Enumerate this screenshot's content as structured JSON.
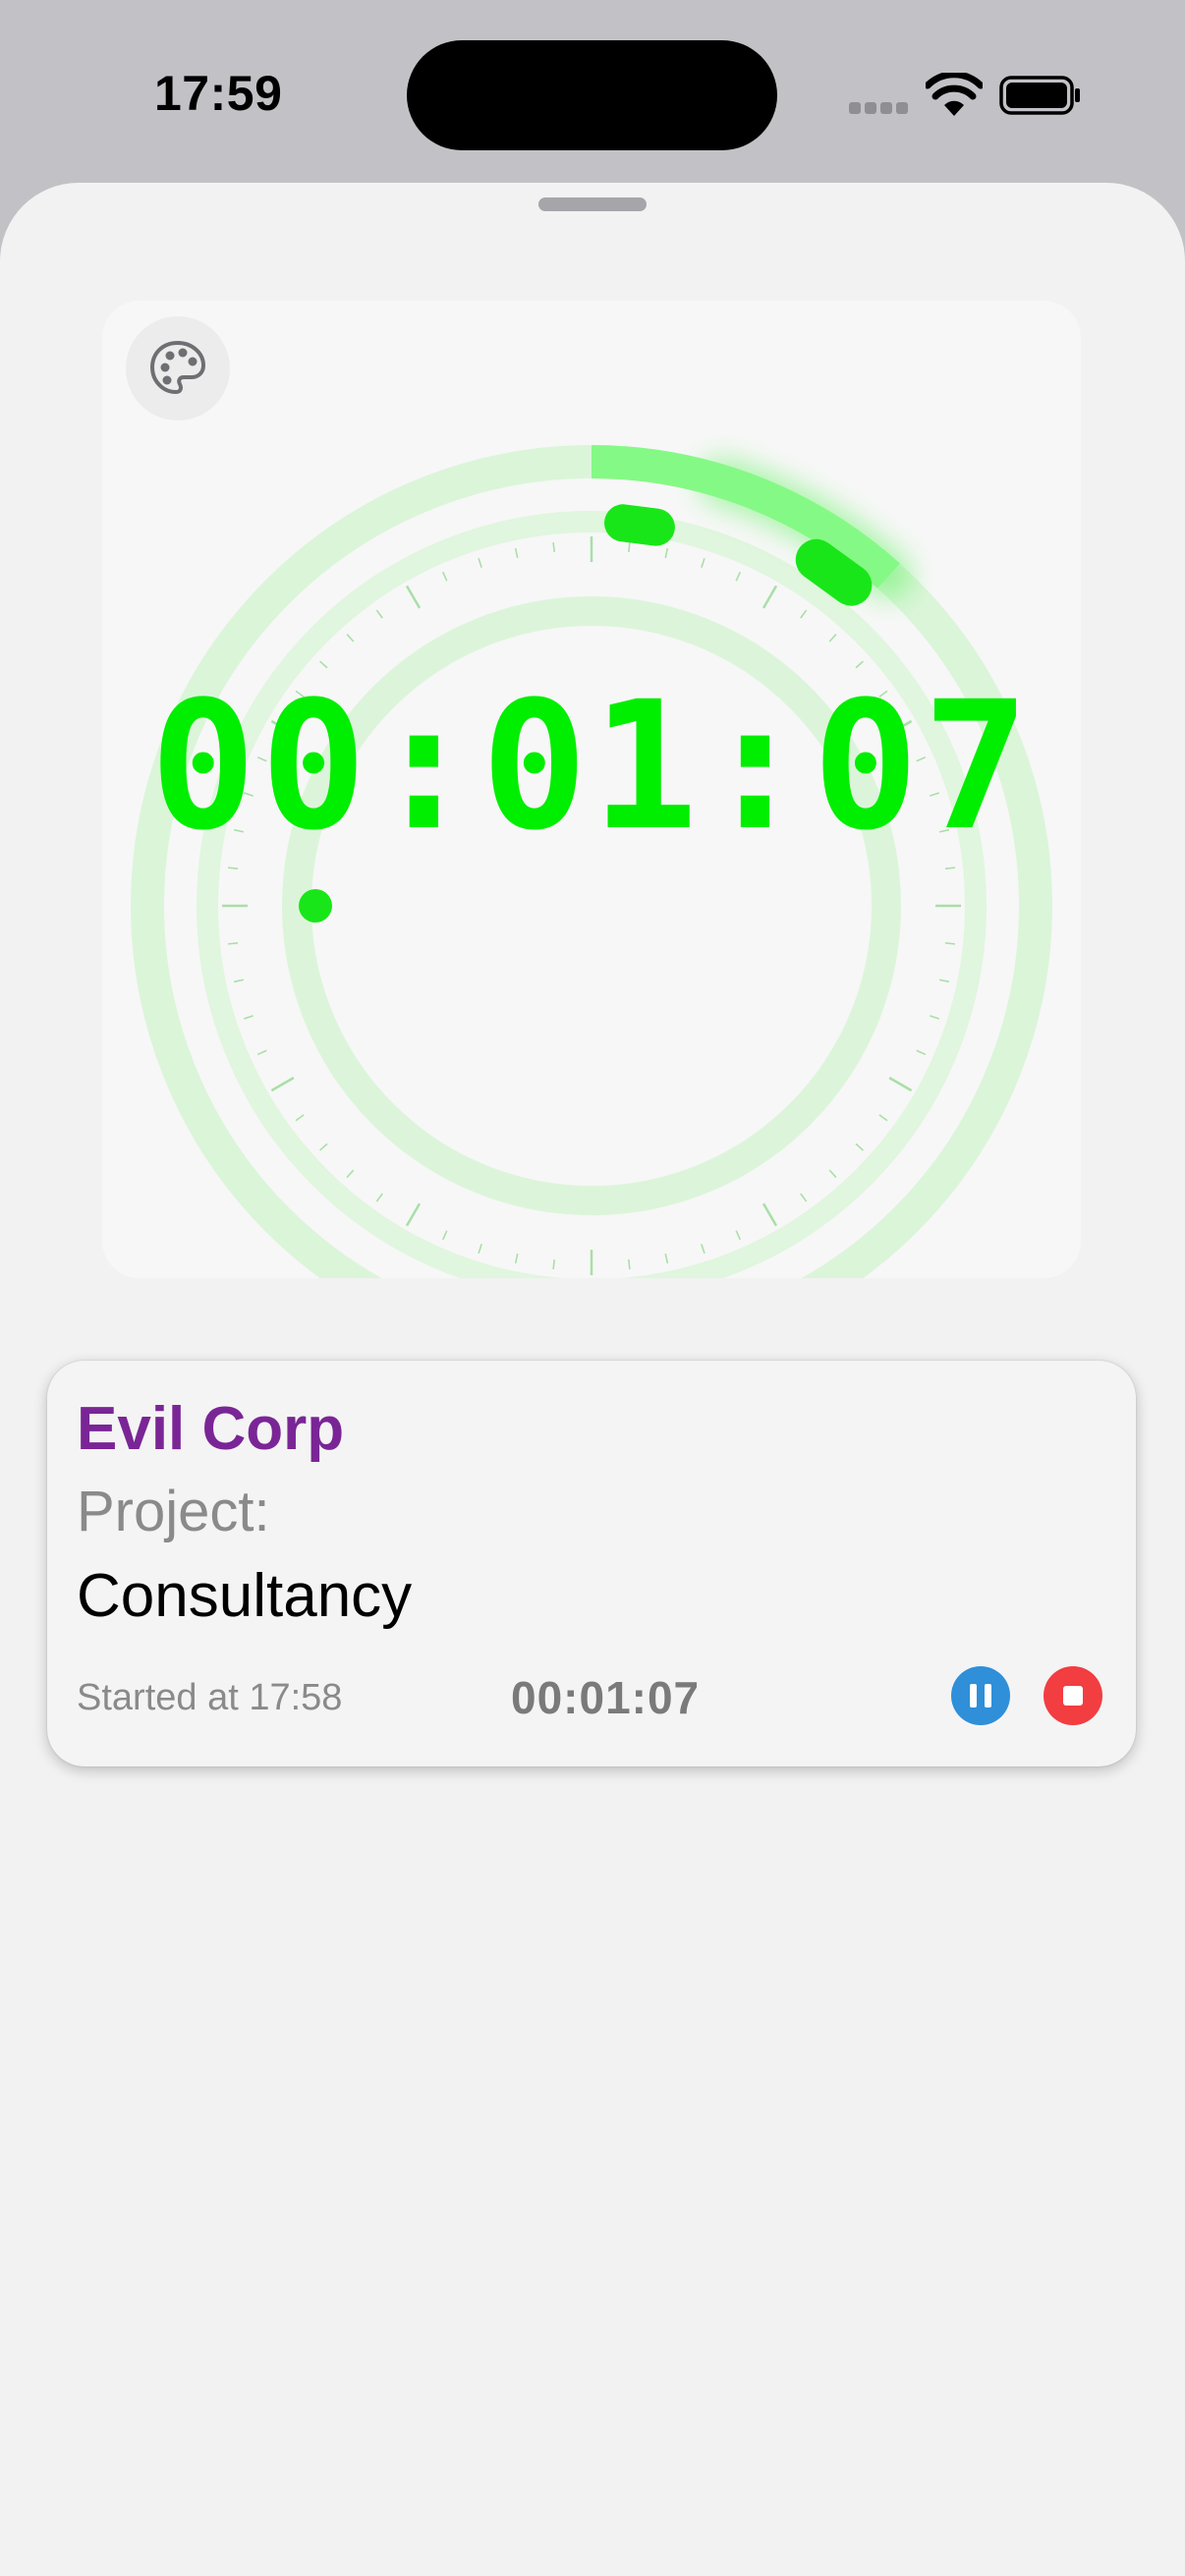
{
  "status_bar": {
    "time": "17:59",
    "wifi_icon": "wifi-icon",
    "battery_icon": "battery-icon"
  },
  "clock": {
    "display_time": "00:01:07",
    "elapsed_seconds": 67,
    "accent_color": "#00ee00",
    "palette_icon": "palette-icon"
  },
  "timer_card": {
    "client": "Evil Corp",
    "client_color": "#7a2596",
    "project_label": "Project:",
    "project": "Consultancy",
    "started": "Started at 17:58",
    "elapsed": "00:01:07",
    "pause_icon": "pause-icon",
    "pause_color": "#2f8fd8",
    "stop_icon": "stop-icon",
    "stop_color": "#f23d41"
  }
}
